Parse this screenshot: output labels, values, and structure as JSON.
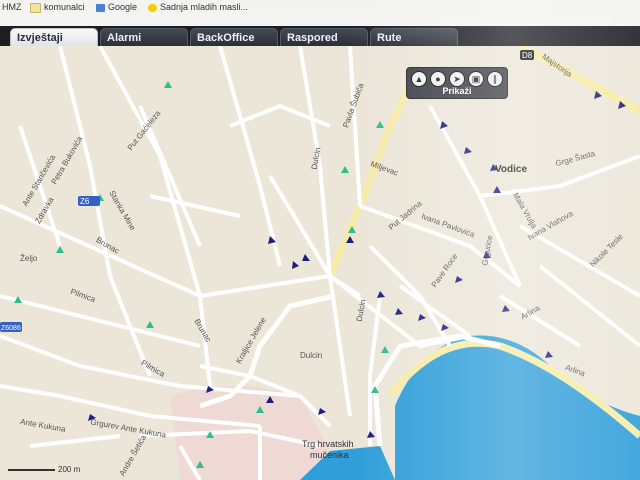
{
  "bookmarks": [
    {
      "label": "HMZ",
      "icon": "none"
    },
    {
      "label": "komunalci",
      "icon": "folder-icon"
    },
    {
      "label": "Google",
      "icon": "google-icon"
    },
    {
      "label": "Sadnja mladih masli...",
      "icon": "bookmark-icon"
    }
  ],
  "tabs": [
    {
      "label": "Izvještaji",
      "active": true
    },
    {
      "label": "Alarmi",
      "active": false
    },
    {
      "label": "BackOffice",
      "active": false
    },
    {
      "label": "Raspored",
      "active": false
    },
    {
      "label": "Rute",
      "active": false
    }
  ],
  "map_controls": {
    "label": "Prikaži",
    "buttons": [
      "compass-icon",
      "pin-icon",
      "cursor-icon",
      "layers-icon",
      "road-icon"
    ]
  },
  "map_labels": {
    "vodice": "Vodice",
    "square": "Trg hrvatskih",
    "square2": "mučenika",
    "scale": "200 m",
    "route_d8": "D8",
    "route_z6": "Z6",
    "route_z6b": "Z6",
    "route_z6c": "Z6086",
    "streets": [
      "Put Gaćeleza",
      "Petra Bukovića",
      "Ante Stančevića",
      "Zdravka",
      "Brunac",
      "Željo",
      "Stanka Mine",
      "Pilmica",
      "Pilmica",
      "Grgurev Ante Kukuna",
      "Ante Kukuna",
      "Andre Šetića",
      "Brunac",
      "Kraljice Jelene",
      "Dulcin",
      "Dulcin",
      "Pavla Šubića",
      "Miljevac",
      "Ivana Pavlovića",
      "Put Jadrina",
      "Pave Roce",
      "Grgurice",
      "Arlina",
      "Arlina",
      "Ivana Vlahova",
      "Nikole Tesle",
      "Grge Šasta",
      "Dulcin",
      "Mala Vrulja",
      "Majstorija"
    ]
  },
  "colors": {
    "sea": "#2f9ed9",
    "land": "#ece6d9",
    "road": "#ffffff",
    "highway": "#f7eba8",
    "tab_bar": "#1c1e22"
  }
}
